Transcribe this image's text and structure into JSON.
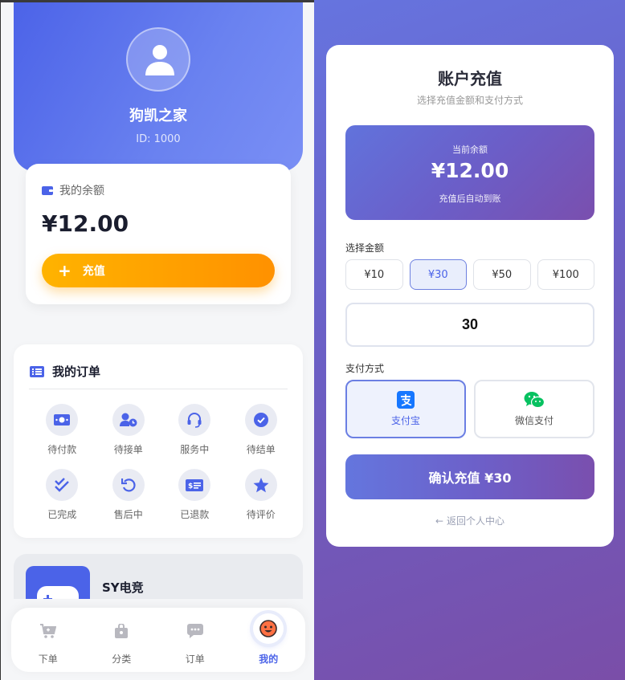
{
  "profile": {
    "name": "狗凯之家",
    "id_text": "ID: 1000"
  },
  "balance": {
    "label": "我的余额",
    "amount": "¥12.00",
    "recharge_label": "充值"
  },
  "orders": {
    "title": "我的订单",
    "items": [
      {
        "label": "待付款",
        "icon": "money-bill-icon"
      },
      {
        "label": "待接单",
        "icon": "user-clock-icon"
      },
      {
        "label": "服务中",
        "icon": "headset-icon"
      },
      {
        "label": "待结单",
        "icon": "check-circle-icon"
      },
      {
        "label": "已完成",
        "icon": "double-check-icon"
      },
      {
        "label": "售后中",
        "icon": "undo-icon"
      },
      {
        "label": "已退款",
        "icon": "money-check-icon"
      },
      {
        "label": "待评价",
        "icon": "star-icon"
      }
    ]
  },
  "game": {
    "title": "SY电竞"
  },
  "tabbar": {
    "items": [
      {
        "label": "下单",
        "icon": "cart-icon"
      },
      {
        "label": "分类",
        "icon": "bag-icon"
      },
      {
        "label": "订单",
        "icon": "chat-icon"
      },
      {
        "label": "我的",
        "icon": "smile-face-icon"
      }
    ],
    "active_index": 3
  },
  "recharge": {
    "title": "账户充值",
    "subtitle": "选择充值金额和支付方式",
    "current_label": "当前余额",
    "current_amount": "¥12.00",
    "current_note": "充值后自动到账",
    "amount_section_label": "选择金额",
    "amount_options": [
      "¥10",
      "¥30",
      "¥50",
      "¥100"
    ],
    "selected_amount_index": 1,
    "custom_amount_value": "30",
    "payment_section_label": "支付方式",
    "payment_options": [
      {
        "label": "支付宝",
        "icon": "alipay-icon"
      },
      {
        "label": "微信支付",
        "icon": "wechat-icon"
      }
    ],
    "selected_payment_index": 0,
    "confirm_label": "确认充值 ¥30",
    "back_label": "返回个人中心"
  },
  "colors": {
    "primary": "#4b63e8",
    "orange": "#ff9800",
    "purple": "#764ba2",
    "alipay": "#1677ff",
    "wechat": "#07c160"
  }
}
